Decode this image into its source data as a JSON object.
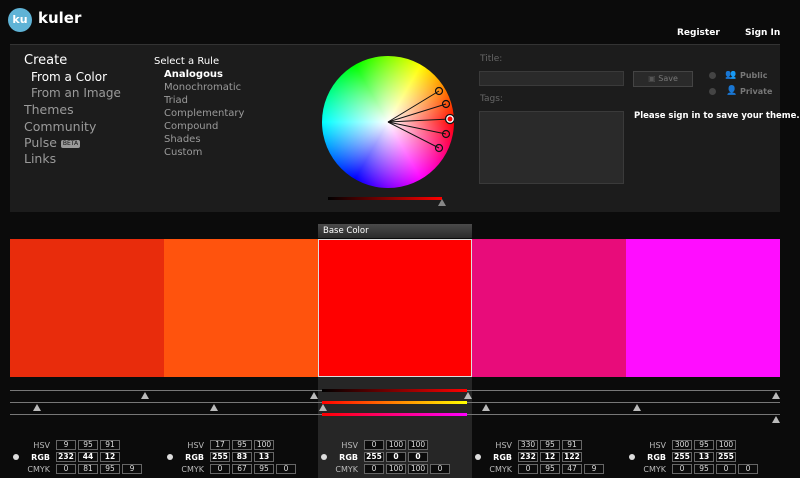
{
  "app": {
    "logo_badge": "ku",
    "name": "kuler"
  },
  "header": {
    "register": "Register",
    "sign_in": "Sign In"
  },
  "nav": {
    "create": "Create",
    "from_color": "From a Color",
    "from_image": "From an Image",
    "themes": "Themes",
    "community": "Community",
    "pulse": "Pulse",
    "beta": "BETA",
    "links": "Links"
  },
  "rules": {
    "heading": "Select a Rule",
    "items": [
      "Analogous",
      "Monochromatic",
      "Triad",
      "Complementary",
      "Compound",
      "Shades",
      "Custom"
    ],
    "selected": "Analogous"
  },
  "form": {
    "title_label": "Title:",
    "tags_label": "Tags:",
    "save_label": "Save",
    "public_label": "Public",
    "private_label": "Private",
    "signin_message": "Please sign in to save your theme."
  },
  "base_color_label": "Base Color",
  "value_labels": {
    "hsv": "HSV",
    "rgb": "RGB",
    "cmyk": "CMYK"
  },
  "swatches": [
    {
      "color": "#E82C0C",
      "hsv": [
        "9",
        "95",
        "91"
      ],
      "rgb": [
        "232",
        "44",
        "12"
      ],
      "cmyk": [
        "0",
        "81",
        "95",
        "9"
      ]
    },
    {
      "color": "#FF530D",
      "hsv": [
        "17",
        "95",
        "100"
      ],
      "rgb": [
        "255",
        "83",
        "13"
      ],
      "cmyk": [
        "0",
        "67",
        "95",
        "0"
      ]
    },
    {
      "color": "#FF0000",
      "hsv": [
        "0",
        "100",
        "100"
      ],
      "rgb": [
        "255",
        "0",
        "0"
      ],
      "cmyk": [
        "0",
        "100",
        "100",
        "0"
      ]
    },
    {
      "color": "#E80C7A",
      "hsv": [
        "330",
        "95",
        "91"
      ],
      "rgb": [
        "232",
        "12",
        "122"
      ],
      "cmyk": [
        "0",
        "95",
        "47",
        "9"
      ]
    },
    {
      "color": "#FF0DFF",
      "hsv": [
        "300",
        "95",
        "100"
      ],
      "rgb": [
        "255",
        "13",
        "255"
      ],
      "cmyk": [
        "0",
        "95",
        "0",
        "0"
      ]
    }
  ],
  "base_index": 2
}
